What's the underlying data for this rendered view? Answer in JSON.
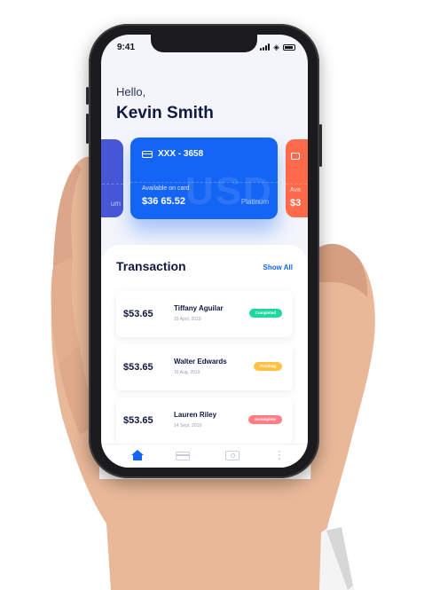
{
  "status_bar": {
    "time": "9:41"
  },
  "greeting": {
    "hello": "Hello,",
    "name": "Kevin Smith"
  },
  "cards": {
    "left": {
      "tier": "um"
    },
    "main": {
      "number": "XXX - 3658",
      "currency_watermark": "USD",
      "available_label": "Available on card",
      "balance": "$36 65.52",
      "tier": "Platinum",
      "color": "#1565f5"
    },
    "right": {
      "available_label": "Ava",
      "balance": "$3",
      "color": "#ff6a4b"
    }
  },
  "transactions": {
    "title": "Transaction",
    "show_all": "Show All",
    "items": [
      {
        "amount": "$53.65",
        "name": "Tiffany Aguilar",
        "date": "15 April, 2019",
        "status": "Completed",
        "status_color": "#1fd8a0"
      },
      {
        "amount": "$53.65",
        "name": "Walter Edwards",
        "date": "16 Aug, 2019",
        "status": "Pending",
        "status_color": "#ffc247"
      },
      {
        "amount": "$53.65",
        "name": "Lauren Riley",
        "date": "14 Sept, 2019",
        "status": "Incomplete",
        "status_color": "#ff7e86"
      }
    ]
  },
  "tabbar": {
    "items": [
      "home-icon",
      "card-icon",
      "wallet-icon",
      "more-icon"
    ],
    "active_color": "#1565f5"
  }
}
